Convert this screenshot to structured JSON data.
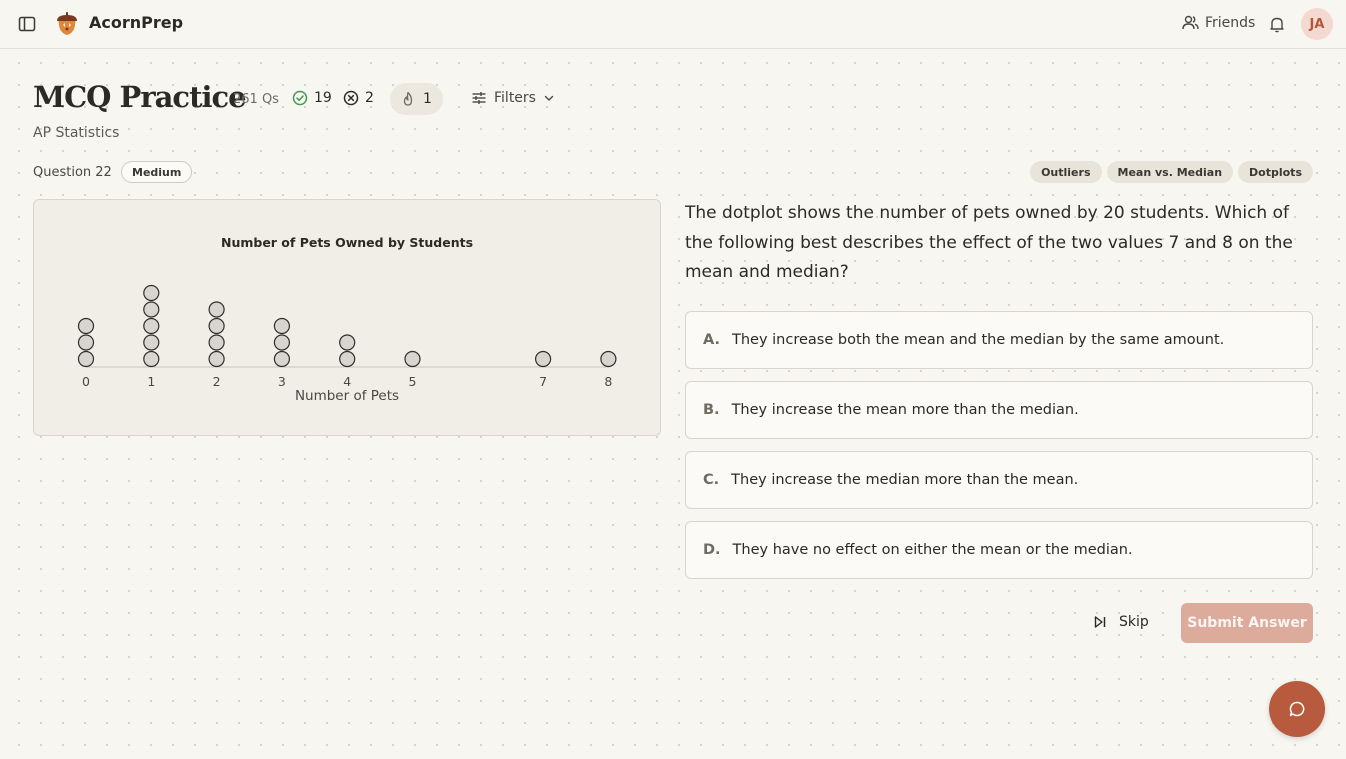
{
  "app": {
    "brand": "AcornPrep"
  },
  "header": {
    "friends_label": "Friends",
    "avatar_initials": "JA"
  },
  "practice": {
    "title": "MCQ Practice",
    "question_count": "261 Qs",
    "correct": "19",
    "incorrect": "2",
    "streak": "1",
    "filters_label": "Filters",
    "subject": "AP Statistics"
  },
  "question": {
    "number_label": "Question 22",
    "difficulty": "Medium",
    "tags": [
      "Outliers",
      "Mean vs. Median",
      "Dotplots"
    ],
    "text": "The dotplot shows the number of pets owned by 20 students. Which of the following best describes the effect of the two values 7 and 8 on the mean and median?",
    "options": [
      {
        "letter": "A.",
        "text": "They increase both the mean and the median by the same amount."
      },
      {
        "letter": "B.",
        "text": "They increase the mean more than the median."
      },
      {
        "letter": "C.",
        "text": "They increase the median more than the mean."
      },
      {
        "letter": "D.",
        "text": "They have no effect on either the mean or the median."
      }
    ],
    "skip_label": "Skip",
    "submit_label": "Submit Answer"
  },
  "chart_data": {
    "type": "scatter",
    "title": "Number of Pets Owned by Students",
    "xlabel": "Number of Pets",
    "ylabel": "",
    "x_ticks": [
      0,
      1,
      2,
      3,
      4,
      5,
      7,
      8
    ],
    "xlim": [
      0,
      8
    ],
    "values": [
      0,
      1,
      2,
      3,
      4,
      5,
      7,
      8
    ],
    "counts": [
      3,
      5,
      4,
      3,
      2,
      1,
      1,
      1
    ],
    "grid": false
  },
  "colors": {
    "accent": "#b75a3e",
    "submit_disabled": "#dcab9c",
    "correct_green": "#3f9a4e"
  },
  "icons": {
    "sidebar": "sidebar-toggle-icon",
    "logo": "acorn-logo-icon",
    "friends": "users-icon",
    "bell": "bell-icon",
    "correct": "check-circle-icon",
    "incorrect": "x-circle-icon",
    "streak": "flame-icon",
    "filters": "sliders-icon",
    "skip": "skip-forward-icon",
    "chat": "chat-bubble-icon"
  }
}
